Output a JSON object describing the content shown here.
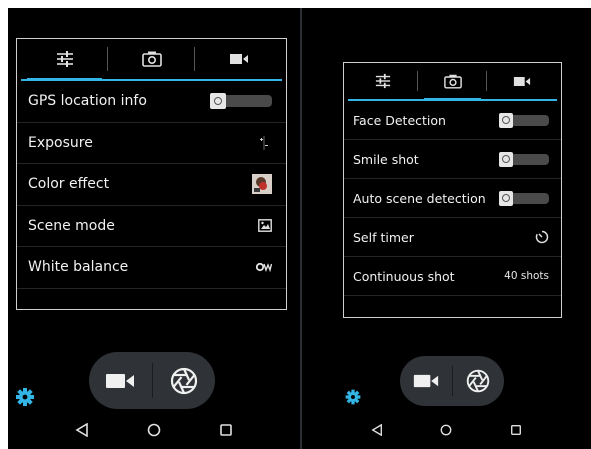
{
  "colors": {
    "accent": "#33b5e5",
    "panel_border": "#cfcfcf",
    "toggle_track": "#4a4a4a",
    "control_pill": "#2f3236"
  },
  "left_screen": {
    "tabs": [
      {
        "icon": "sliders-icon",
        "active": true
      },
      {
        "icon": "camera-icon",
        "active": false
      },
      {
        "icon": "video-icon",
        "active": false
      }
    ],
    "settings": [
      {
        "label": "GPS location info",
        "control": "toggle",
        "state": "off"
      },
      {
        "label": "Exposure",
        "control": "icon",
        "icon": "exposure-icon"
      },
      {
        "label": "Color effect",
        "control": "icon",
        "icon": "color-effect-icon"
      },
      {
        "label": "Scene mode",
        "control": "icon",
        "icon": "scene-mode-icon"
      },
      {
        "label": "White balance",
        "control": "icon",
        "icon": "white-balance-icon"
      }
    ]
  },
  "right_screen": {
    "tabs": [
      {
        "icon": "sliders-icon",
        "active": false
      },
      {
        "icon": "camera-icon",
        "active": true
      },
      {
        "icon": "video-icon",
        "active": false
      }
    ],
    "settings": [
      {
        "label": "Face Detection",
        "control": "toggle",
        "state": "off"
      },
      {
        "label": "Smile shot",
        "control": "toggle",
        "state": "off"
      },
      {
        "label": "Auto scene detection",
        "control": "toggle",
        "state": "off"
      },
      {
        "label": "Self timer",
        "control": "icon",
        "icon": "timer-icon"
      },
      {
        "label": "Continuous shot",
        "control": "value",
        "value": "40 shots"
      }
    ]
  },
  "bottom_controls": {
    "left_button": "video-record-icon",
    "right_button": "shutter-icon",
    "settings": "gear-icon"
  },
  "navigation": [
    "back-icon",
    "home-icon",
    "recents-icon"
  ]
}
